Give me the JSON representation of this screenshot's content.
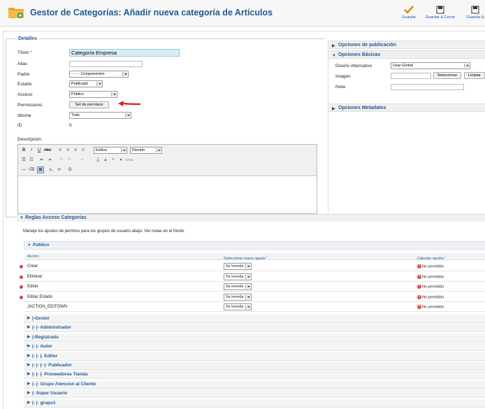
{
  "header": {
    "title": "Gestor de Categorías: Añadir nueva categoría de Artículos",
    "buttons": [
      {
        "label": "Guardar",
        "icon": "checkmark-icon"
      },
      {
        "label": "Guardar & Cerrar",
        "icon": "save-icon"
      },
      {
        "label": "Guardar &",
        "icon": "save-new-icon"
      }
    ]
  },
  "details": {
    "legend": "Detalles",
    "title_label": "Título",
    "required_mark": "*",
    "title_value": "Categoría Empresa",
    "alias_label": "Alias",
    "alias_value": "",
    "parent_label": "Padre",
    "parent_value": "- - - - Componentes",
    "state_label": "Estado",
    "state_value": "Publicado",
    "access_label": "Acceso",
    "access_value": "Público",
    "permissions_label": "Permissions",
    "permissions_button": "Set de permisos",
    "language_label": "Idioma",
    "language_value": "Todo",
    "id_label": "ID",
    "id_value": "0",
    "description_label": "Descripción"
  },
  "editor": {
    "styles_value": "Estilos",
    "format_value": "Párrafo"
  },
  "right": {
    "publish_options": "Opciones de publicación",
    "basic_options": "Opciones Básicas",
    "alt_layout_label": "Diseño Alternativo",
    "alt_layout_value": "Usar Global",
    "image_label": "Imagen",
    "select_button": "Seleccionar",
    "clear_button": "Limpiar",
    "note_label": "Nota",
    "metadata_options": "Opciones Metadatos"
  },
  "acl": {
    "title": "Reglas Acceso Categorías",
    "intro": "Maneje los ajustes de permiso para los grupos de usuario abajo. Ver notas en el fondo.",
    "group": "Público",
    "headers": {
      "action": "Acción",
      "new_setting": "Seleccione nuevo ajuste",
      "calculated": "Calcular opción",
      "info": "i"
    },
    "rows": [
      {
        "action": "Crear",
        "setting": "Se hereda",
        "calc": "No permitido"
      },
      {
        "action": "Eliminar",
        "setting": "Se hereda",
        "calc": "No permitido"
      },
      {
        "action": "Editar",
        "setting": "Se hereda",
        "calc": "No permitido"
      },
      {
        "action": "Editar Estado",
        "setting": "Se hereda",
        "calc": "No permitido"
      },
      {
        "action": "JACTION_EDITOWN",
        "setting": "Se hereda",
        "calc": "No permitido"
      }
    ],
    "groups": [
      "|-Gestor",
      "|- |- Administrador",
      "|-Registrado",
      "|- |- Autor",
      "|- |- |- Editor",
      "|- |- |- |- Publicador",
      "|- |- |- Proveedores Tienda",
      "|- |- Grupo Atencion al Cliente",
      "|- Super Usuario",
      "|- |- grupo1"
    ]
  }
}
